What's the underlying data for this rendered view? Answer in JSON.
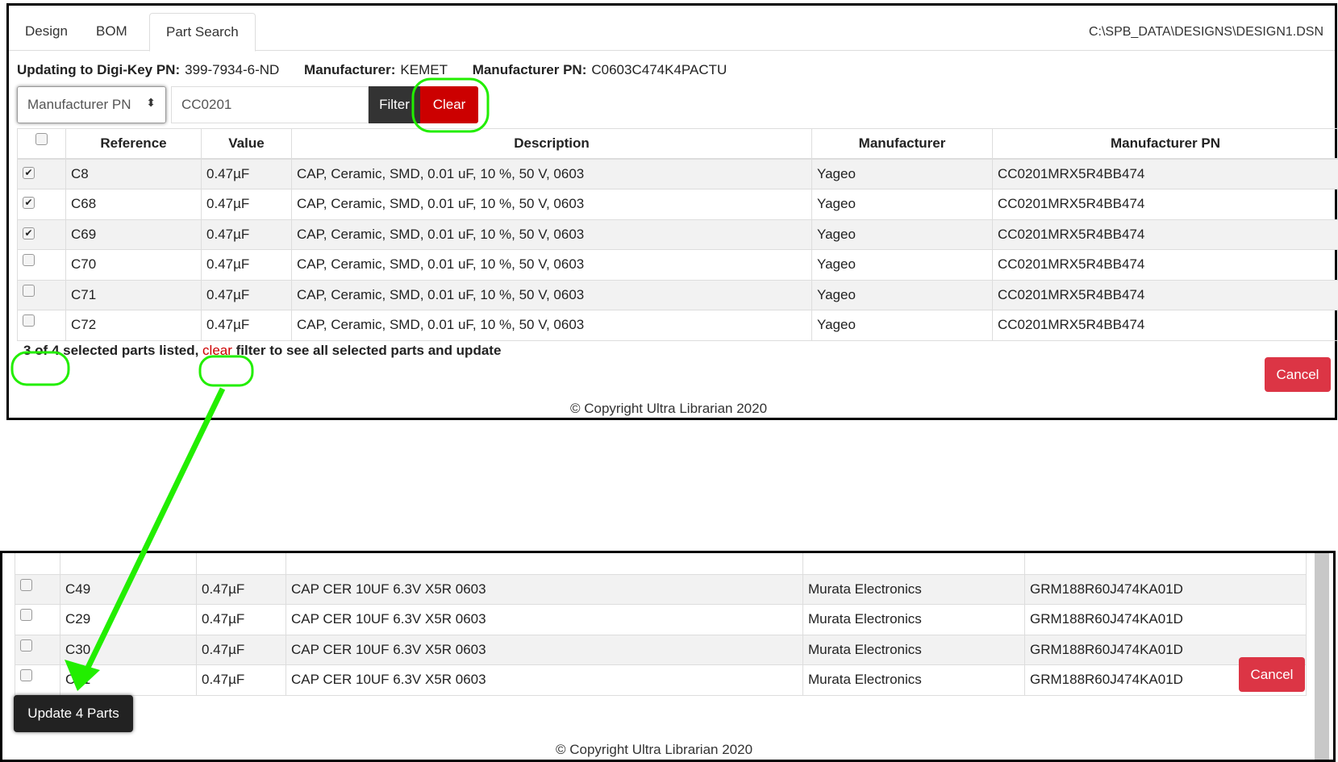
{
  "tabs": [
    "Design",
    "BOM",
    "Part Search"
  ],
  "active_tab": "Part Search",
  "file_path": "C:\\SPB_DATA\\DESIGNS\\DESIGN1.DSN",
  "info": {
    "digikey_label": "Updating to Digi-Key PN:",
    "digikey_value": "399-7934-6-ND",
    "manufacturer_label": "Manufacturer:",
    "manufacturer_value": "KEMET",
    "mpn_label": "Manufacturer PN:",
    "mpn_value": "C0603C474K4PACTU"
  },
  "filter": {
    "field": "Manufacturer PN",
    "value": "CC0201",
    "filter_label": "Filter",
    "clear_label": "Clear"
  },
  "columns": [
    "Reference",
    "Value",
    "Description",
    "Manufacturer",
    "Manufacturer PN"
  ],
  "top_rows": [
    {
      "checked": true,
      "cells": [
        "C8",
        "0.47µF",
        "CAP, Ceramic, SMD, 0.01 uF, 10 %, 50 V, 0603",
        "Yageo",
        "CC0201MRX5R4BB474"
      ]
    },
    {
      "checked": true,
      "cells": [
        "C68",
        "0.47µF",
        "CAP, Ceramic, SMD, 0.01 uF, 10 %, 50 V, 0603",
        "Yageo",
        "CC0201MRX5R4BB474"
      ]
    },
    {
      "checked": true,
      "cells": [
        "C69",
        "0.47µF",
        "CAP, Ceramic, SMD, 0.01 uF, 10 %, 50 V, 0603",
        "Yageo",
        "CC0201MRX5R4BB474"
      ]
    },
    {
      "checked": false,
      "cells": [
        "C70",
        "0.47µF",
        "CAP, Ceramic, SMD, 0.01 uF, 10 %, 50 V, 0603",
        "Yageo",
        "CC0201MRX5R4BB474"
      ]
    },
    {
      "checked": false,
      "cells": [
        "C71",
        "0.47µF",
        "CAP, Ceramic, SMD, 0.01 uF, 10 %, 50 V, 0603",
        "Yageo",
        "CC0201MRX5R4BB474"
      ]
    },
    {
      "checked": false,
      "cells": [
        "C72",
        "0.47µF",
        "CAP, Ceramic, SMD, 0.01 uF, 10 %, 50 V, 0603",
        "Yageo",
        "CC0201MRX5R4BB474"
      ]
    }
  ],
  "status": {
    "count": "3 of 4",
    "text1": " selected parts listed, ",
    "link": "clear",
    "text2": " filter to see all selected parts and update"
  },
  "cancel_label": "Cancel",
  "copyright": "© Copyright Ultra Librarian 2020",
  "bottom_rows": [
    {
      "checked": false,
      "cells": [
        "C49",
        "0.47µF",
        "CAP CER 10UF 6.3V X5R 0603",
        "Murata Electronics",
        "GRM188R60J474KA01D"
      ]
    },
    {
      "checked": false,
      "cells": [
        "C29",
        "0.47µF",
        "CAP CER 10UF 6.3V X5R 0603",
        "Murata Electronics",
        "GRM188R60J474KA01D"
      ]
    },
    {
      "checked": false,
      "cells": [
        "C30",
        "0.47µF",
        "CAP CER 10UF 6.3V X5R 0603",
        "Murata Electronics",
        "GRM188R60J474KA01D"
      ]
    },
    {
      "checked": false,
      "cells": [
        "C31",
        "0.47µF",
        "CAP CER 10UF 6.3V X5R 0603",
        "Murata Electronics",
        "GRM188R60J474KA01D"
      ]
    }
  ],
  "update_label": "Update 4 Parts",
  "colors": {
    "danger": "#dc3545",
    "clear_red": "#cc0000",
    "annotation_green": "#22ee00",
    "dark": "#222222"
  }
}
